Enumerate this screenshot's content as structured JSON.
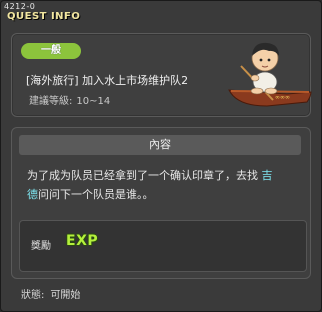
{
  "quest": {
    "id": "4212-0",
    "header_title": "QUEST INFO",
    "category_badge": "一般",
    "name": "[海外旅行] 加入水上市场维护队2",
    "level_label": "建議等級:",
    "level_range": "10~14",
    "section_title": "內容",
    "description_before": "为了成为队员已经拿到了一个确认印章了，去找 ",
    "npc_name_part1": "吉",
    "npc_name_part2": "德",
    "description_after": "问问下一个队员是谁。。",
    "reward_label": "獎勵",
    "reward_item": "EXP",
    "status_label": "狀態:",
    "status_value": "可開始"
  },
  "colors": {
    "badge_bg": "#8cc43c",
    "npc_highlight": "#7ee6f0",
    "exp_text": "#b4f03c",
    "title_text": "#f2e6a0"
  },
  "icons": {
    "title_icon": "scroll-icon",
    "illustration": "boy-in-boat-illustration"
  }
}
